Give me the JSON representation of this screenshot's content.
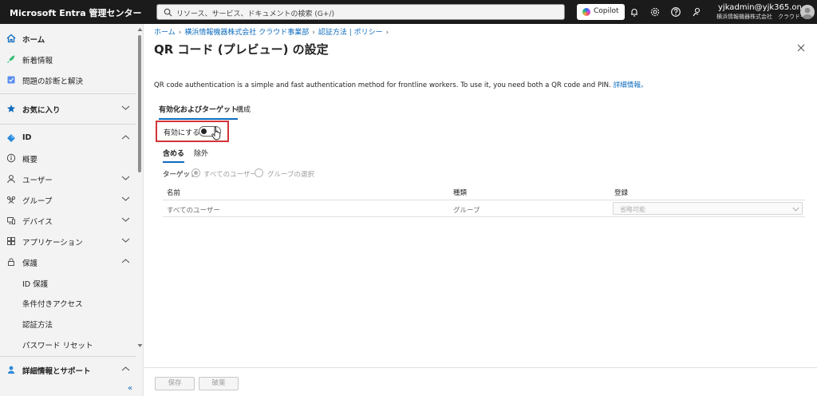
{
  "header": {
    "app_title": "Microsoft Entra 管理センター",
    "search_placeholder": "リソース、サービス、ドキュメントの検索 (G+/)",
    "copilot_label": "Copilot",
    "account_name": "yjkadmin@yjk365.on···",
    "account_tenant": "横浜情報機器株式会社　クラウド···"
  },
  "sidebar": {
    "items": [
      {
        "label": "ホーム",
        "icon": "home-icon"
      },
      {
        "label": "新着情報",
        "icon": "rocket-icon"
      },
      {
        "label": "問題の診断と解決",
        "icon": "diagnose-icon"
      },
      {
        "label": "お気に入り",
        "icon": "star-icon"
      },
      {
        "label": "ID",
        "icon": "identity-icon"
      },
      {
        "label": "概要",
        "icon": "info-icon"
      },
      {
        "label": "ユーザー",
        "icon": "user-icon"
      },
      {
        "label": "グループ",
        "icon": "group-icon"
      },
      {
        "label": "デバイス",
        "icon": "device-icon"
      },
      {
        "label": "アプリケーション",
        "icon": "apps-icon"
      },
      {
        "label": "保護",
        "icon": "lock-icon"
      },
      {
        "label": "ID 保護"
      },
      {
        "label": "条件付きアクセス"
      },
      {
        "label": "認証方法"
      },
      {
        "label": "パスワード リセット"
      },
      {
        "label": "詳細情報とサポート",
        "icon": "support-icon"
      }
    ],
    "collapse_label": "«"
  },
  "main": {
    "breadcrumb": [
      "ホーム",
      "横浜情報機器株式会社 クラウド事業部",
      "認証方法 | ポリシー"
    ],
    "title": "QR コード (プレビュー) の設定",
    "more": "···",
    "description": "QR code authentication is a simple and fast authentication method for frontline workers. To use it, you need both a QR code and PIN.",
    "learn_more": "詳細情報。",
    "tabs": [
      "有効化およびターゲット",
      "構成"
    ],
    "enable_label": "有効にする",
    "enabled": false,
    "subtabs": [
      "含める",
      "除外"
    ],
    "target_label": "ターゲット",
    "target_options": [
      "すべてのユーザー",
      "グループの選択"
    ],
    "target_selected": "すべてのユーザー",
    "table": {
      "columns": [
        "名前",
        "種類",
        "登録"
      ],
      "rows": [
        {
          "name": "すべてのユーザー",
          "type": "グループ",
          "registration": "省略可能"
        }
      ]
    },
    "footer": {
      "save": "保存",
      "discard": "破棄"
    }
  },
  "colors": {
    "accent": "#0f6cbd",
    "highlight_border": "#d13438",
    "topbar": "#1b1b1b"
  }
}
